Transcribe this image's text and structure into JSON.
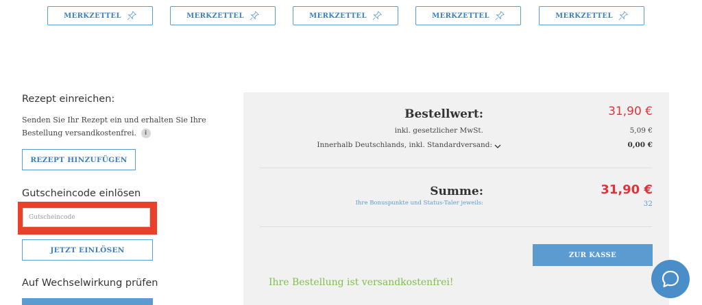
{
  "merkzettel": {
    "buttons": [
      {
        "label": "MERKZETTEL"
      },
      {
        "label": "MERKZETTEL"
      },
      {
        "label": "MERKZETTEL"
      },
      {
        "label": "MERKZETTEL"
      },
      {
        "label": "MERKZETTEL"
      }
    ],
    "icon": "pin-icon"
  },
  "rezept": {
    "heading": "Rezept einreichen:",
    "description": "Senden Sie Ihr Rezept ein und erhalten Sie Ihre Bestellung versandkostenfrei.",
    "info_icon_glyph": "i",
    "button_label": "REZEPT HINZUFÜGEN"
  },
  "gutschein": {
    "heading": "Gutscheincode einlösen",
    "placeholder": "Gutscheincode",
    "value": "",
    "button_label": "JETZT EINLÖSEN"
  },
  "wechselwirkung": {
    "heading": "Auf Wechselwirkung prüfen"
  },
  "summary": {
    "bestellwert_label": "Bestellwert:",
    "bestellwert_value": "31,90 €",
    "mwst_label": "inkl. gesetzlicher MwSt.",
    "mwst_value": "5,09 €",
    "versand_label": "Innerhalb Deutschlands, inkl. Standardversand:",
    "versand_value": "0,00 €",
    "summe_label": "Summe:",
    "summe_value": "31,90 €",
    "bonus_label": "Ihre Bonuspunkte und Status-Taler jeweils:",
    "bonus_value": "32",
    "kasse_button": "ZUR KASSE",
    "free_shipping_msg": "Ihre Bestellung ist versandkostenfrei!"
  },
  "colors": {
    "accent_blue": "#5b9bd0",
    "price_red": "#e0343c",
    "success_green": "#7fbf4a",
    "highlight_red": "#e8402a"
  },
  "chat": {
    "icon": "chat-bubble-icon"
  }
}
